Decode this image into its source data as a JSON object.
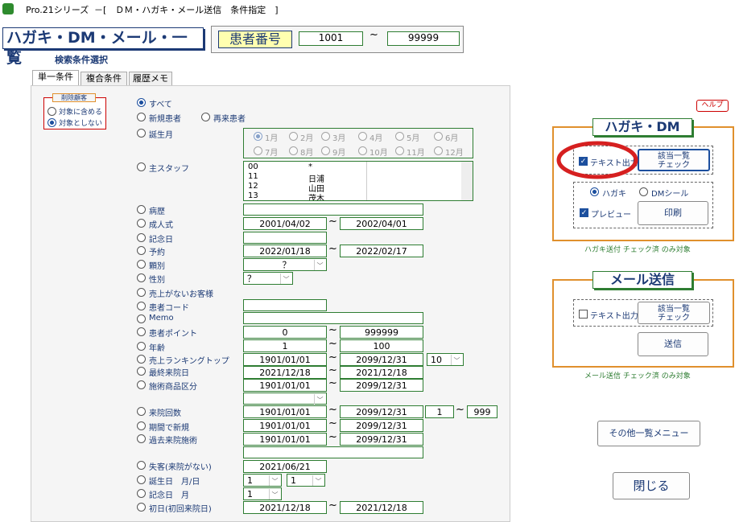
{
  "titlebar": {
    "app": "Pro.21シリーズ",
    "title": "－[　ＤＭ・ハガキ・メール送信　条件指定　]"
  },
  "header": {
    "main_title": "ハガキ・DM・メール・一覧",
    "patient_label": "患者番号",
    "from": "1001",
    "tilde": "~",
    "to": "99999"
  },
  "search_label": "検索条件選択",
  "tabs": [
    "単一条件",
    "複合条件",
    "履歴メモ"
  ],
  "exclude": {
    "title": "削除顧客",
    "opt1": "対象に含める",
    "opt2": "対象としない"
  },
  "conditions": {
    "all": "すべて",
    "new": "新規患者",
    "repeat": "再来患者",
    "birth_month": "誕生月",
    "staff": "主スタッフ",
    "history": "病歴",
    "adult": "成人式",
    "anniv": "記念日",
    "reserve": "予約",
    "category": "顆別",
    "gender": "性別",
    "no_sales": "売上がないお客様",
    "patient_code": "患者コード",
    "memo": "Memo",
    "points": "患者ポイント",
    "age": "年齢",
    "ranking": "売上ランキングトップ",
    "last_visit": "最終来院日",
    "treatment": "施術商品区分",
    "visits": "来院回数",
    "new_period": "期間で新規",
    "past_treatment": "過去来院施術",
    "lapsed": "失客(来院がない)",
    "birthday": "誕生日　月/日",
    "anniv2": "記念日　月",
    "first_visit": "初日(初回来院日)"
  },
  "months": [
    "1月",
    "2月",
    "3月",
    "4月",
    "5月",
    "6月",
    "7月",
    "8月",
    "9月",
    "10月",
    "11月",
    "12月"
  ],
  "staff_list": [
    [
      "00",
      "*"
    ],
    [
      "11",
      "日浦"
    ],
    [
      "12",
      "山田"
    ],
    [
      "13",
      "茂木"
    ]
  ],
  "values": {
    "adult_from": "2001/04/02",
    "adult_to": "2002/04/01",
    "reserve_from": "2022/01/18",
    "reserve_to": "2022/02/17",
    "category": "？",
    "gender": "？",
    "points_from": "0",
    "points_to": "999999",
    "age_from": "1",
    "age_to": "100",
    "rank_from": "1901/01/01",
    "rank_to": "2099/12/31",
    "rank_top": "10",
    "last_from": "2021/12/18",
    "last_to": "2021/12/18",
    "treat_from": "1901/01/01",
    "treat_to": "2099/12/31",
    "visits_from": "1901/01/01",
    "visits_to": "2099/12/31",
    "visits_min": "1",
    "visits_max": "999",
    "newp_from": "1901/01/01",
    "newp_to": "2099/12/31",
    "past_from": "1901/01/01",
    "past_to": "2099/12/31",
    "lapsed": "2021/06/21",
    "bd_month": "1",
    "bd_day": "1",
    "anniv_month": "1",
    "first_from": "2021/12/18",
    "first_to": "2021/12/18"
  },
  "help": "ヘルプ",
  "hagaki": {
    "title": "ハガキ・DM",
    "text_out": "テキスト出力",
    "check_btn1": "該当一覧",
    "check_btn2": "チェック",
    "opt_hagaki": "ハガキ",
    "opt_dm": "DMシール",
    "preview": "プレビュー",
    "print": "印刷",
    "note": "ハガキ送付 チェック済 のみ対象"
  },
  "mail": {
    "title": "メール送信",
    "text_out": "テキスト出力",
    "check_btn1": "該当一覧",
    "check_btn2": "チェック",
    "send": "送信",
    "note": "メール送信 チェック済 のみ対象"
  },
  "other_menu": "その他一覧メニュー",
  "close": "閉じる",
  "colors": {
    "accent": "#1c3a75",
    "green_border": "#2e7d32",
    "orange": "#e0902d",
    "annotation": "#d62020"
  }
}
